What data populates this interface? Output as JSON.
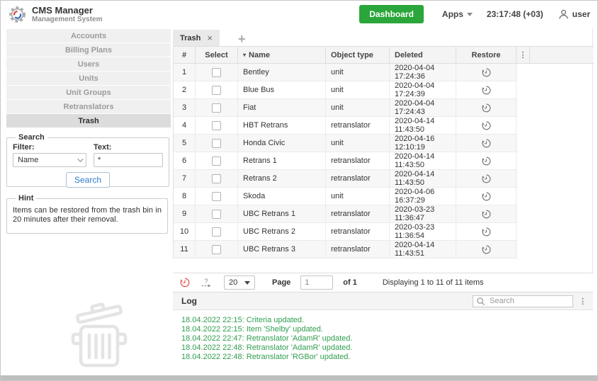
{
  "header": {
    "app_title": "CMS Manager",
    "app_subtitle": "Management System",
    "dashboard_button": "Dashboard",
    "apps_label": "Apps",
    "clock": "23:17:48 (+03)",
    "username": "user"
  },
  "sidebar": {
    "items": [
      {
        "label": "Accounts"
      },
      {
        "label": "Billing Plans"
      },
      {
        "label": "Users"
      },
      {
        "label": "Units"
      },
      {
        "label": "Unit Groups"
      },
      {
        "label": "Retranslators"
      },
      {
        "label": "Trash",
        "active": true
      }
    ]
  },
  "search_panel": {
    "legend": "Search",
    "filter_label": "Filter:",
    "filter_value": "Name",
    "text_label": "Text:",
    "text_value": "*",
    "button_label": "Search"
  },
  "hint_panel": {
    "legend": "Hint",
    "text": "Items can be restored from the trash bin in 20 minutes after their removal."
  },
  "tab": {
    "label": "Trash",
    "close": "×",
    "add": "+"
  },
  "table": {
    "headers": [
      "#",
      "Select",
      "Name",
      "Object type",
      "Deleted",
      "Restore"
    ],
    "sort_arrow": "▾",
    "menu_icon": "⋮",
    "rows": [
      {
        "num": "1",
        "name": "Bentley",
        "type": "unit",
        "deleted": "2020-04-04 17:24:36"
      },
      {
        "num": "2",
        "name": "Blue Bus",
        "type": "unit",
        "deleted": "2020-04-04 17:24:39"
      },
      {
        "num": "3",
        "name": "Fiat",
        "type": "unit",
        "deleted": "2020-04-04 17:24:43"
      },
      {
        "num": "4",
        "name": "HBT Retrans",
        "type": "retranslator",
        "deleted": "2020-04-14 11:43:50"
      },
      {
        "num": "5",
        "name": "Honda Civic",
        "type": "unit",
        "deleted": "2020-04-16 12:10:19"
      },
      {
        "num": "6",
        "name": "Retrans 1",
        "type": "retranslator",
        "deleted": "2020-04-14 11:43:50"
      },
      {
        "num": "7",
        "name": "Retrans 2",
        "type": "retranslator",
        "deleted": "2020-04-14 11:43:50"
      },
      {
        "num": "8",
        "name": "Skoda",
        "type": "unit",
        "deleted": "2020-04-06 16:37:29"
      },
      {
        "num": "9",
        "name": "UBC Retrans 1",
        "type": "retranslator",
        "deleted": "2020-03-23 11:36:47"
      },
      {
        "num": "10",
        "name": "UBC Retrans 2",
        "type": "retranslator",
        "deleted": "2020-03-23 11:36:54"
      },
      {
        "num": "11",
        "name": "UBC Retrans 3",
        "type": "retranslator",
        "deleted": "2020-04-14 11:43:51"
      }
    ]
  },
  "pagination": {
    "page_size": "20",
    "page_label": "Page",
    "page_value": "1",
    "of_label": "of 1",
    "summary": "Displaying 1 to 11 of 11 items"
  },
  "log": {
    "title": "Log",
    "search_placeholder": "Search",
    "entries": [
      "18.04.2022 22:15: Criteria updated.",
      "18.04.2022 22:15: Item 'Shelby' updated.",
      "18.04.2022 22:47: Retranslator 'AdamR' updated.",
      "18.04.2022 22:48: Retranslator 'AdamR' updated.",
      "18.04.2022 22:48: Retranslator 'RGBor' updated."
    ]
  },
  "colors": {
    "accent_green": "#2aa63a",
    "log_green": "#2f9e4e",
    "link_blue": "#2b7cd3",
    "restore_red": "#e05b5b"
  }
}
